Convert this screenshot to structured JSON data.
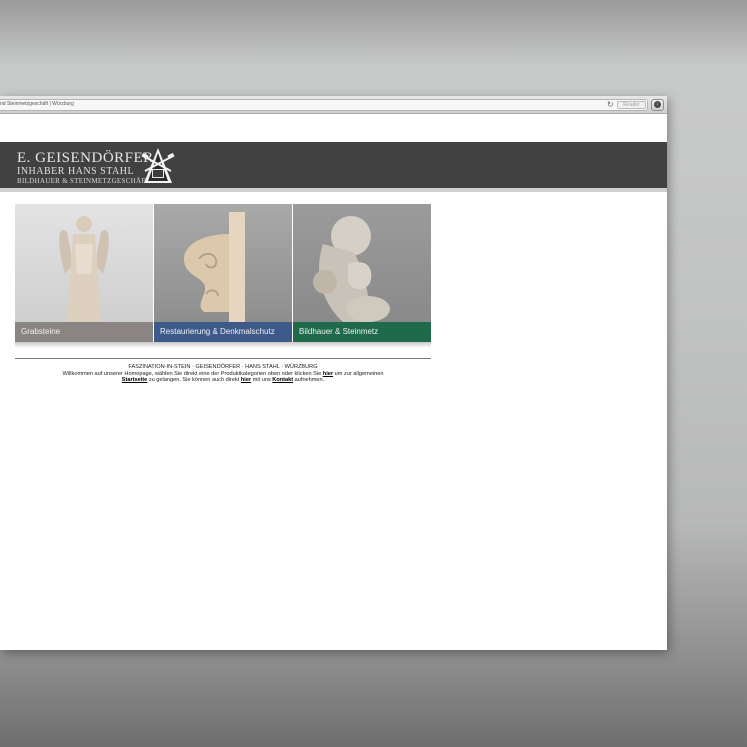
{
  "browser": {
    "address_text": "nd Steinmetzgeschäft | Würzburg",
    "reader_label": "Reader"
  },
  "logo": {
    "line1": "E. GEISENDÖRFER",
    "line2": "INHABER HANS STAHL",
    "line3": "BILDHAUER & STEINMETZGESCHÄFT"
  },
  "tiles": [
    {
      "caption": "Grabsteine"
    },
    {
      "caption": "Restaurierung & Denkmalschutz"
    },
    {
      "caption": "Bildhauer & Steinmetz"
    }
  ],
  "footer": {
    "headline": "FASZINATION-IN-STEIN · GEISENDÖRFER · HANS STAHL · WÜRZBURG",
    "text1": "Willkommen auf unserer Homepage, wählen Sie direkt eine der Produktkategorien oben oder klicken Sie ",
    "link_hier1": "hier",
    "text2": " um zur allgemeinen",
    "link_startseite": "Startseite",
    "text3": " zu gelangen. Sie können auch direkt ",
    "link_hier2": "hier",
    "text4": " mit uns ",
    "link_kontakt": "Kontakt",
    "text5": " aufnehmen."
  }
}
